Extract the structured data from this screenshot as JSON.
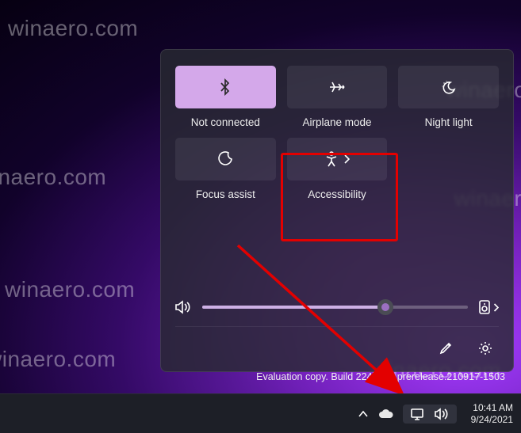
{
  "watermark": "winaero.com",
  "panel": {
    "tiles": [
      {
        "id": "bluetooth",
        "label": "Not connected",
        "active": true
      },
      {
        "id": "airplane",
        "label": "Airplane mode",
        "active": false
      },
      {
        "id": "nightlight",
        "label": "Night light",
        "active": false
      },
      {
        "id": "focusassist",
        "label": "Focus assist",
        "active": false
      },
      {
        "id": "accessibility",
        "label": "Accessibility",
        "active": false,
        "hasChevron": true,
        "highlighted": true
      }
    ],
    "volume_percent": 69
  },
  "desktop_text": "Evaluation copy. Build 22463rs_prerelease.210917-1503",
  "taskbar": {
    "time": "10:41 AM",
    "date": "9/24/2021"
  }
}
